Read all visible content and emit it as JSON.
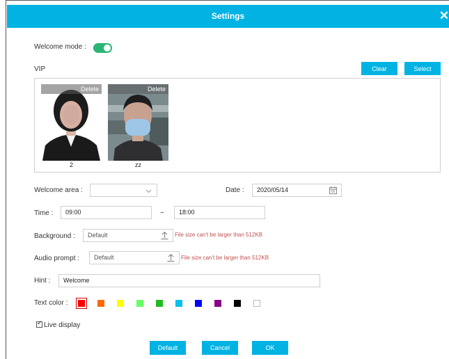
{
  "dialog": {
    "title": "Settings",
    "close_glyph": "✕"
  },
  "welcome_mode": {
    "label": "Welcome mode :",
    "enabled": true
  },
  "vip": {
    "label": "VIP",
    "clear_label": "Clear",
    "select_label": "Select",
    "people": [
      {
        "name": "2",
        "delete_label": "Delete"
      },
      {
        "name": "zz",
        "delete_label": "Delete"
      }
    ]
  },
  "welcome_area": {
    "label": "Welcome area :",
    "value": "",
    "icon": "chevron-down-icon"
  },
  "date": {
    "label": "Date :",
    "value": "2020/05/14",
    "icon": "calendar-icon"
  },
  "time": {
    "label": "Time :",
    "start": "09:00",
    "separator": "~",
    "end": "18:00"
  },
  "background": {
    "label": "Background :",
    "value": "Default",
    "note": "File size can't be larger than 512KB",
    "icon": "upload-icon"
  },
  "audio_prompt": {
    "label": "Audio prompt :",
    "value": "Default",
    "note": "File size can't be larger than 512KB",
    "icon": "upload-icon"
  },
  "hint": {
    "label": "Hint :",
    "value": "Welcome"
  },
  "text_color": {
    "label": "Text color :",
    "selected_index": 0,
    "colors": [
      "#ff0000",
      "#ff6a00",
      "#ffff00",
      "#66ff66",
      "#22bb22",
      "#00c0f0",
      "#0000ff",
      "#8b008b",
      "#000000",
      "#ffffff"
    ]
  },
  "live_display": {
    "label": "Live display",
    "checked": true
  },
  "footer": {
    "default_label": "Default",
    "cancel_label": "Cancel",
    "ok_label": "OK"
  },
  "accent_color": "#00b3e3",
  "toggle_color": "#2bb673",
  "error_color": "#c0504d"
}
